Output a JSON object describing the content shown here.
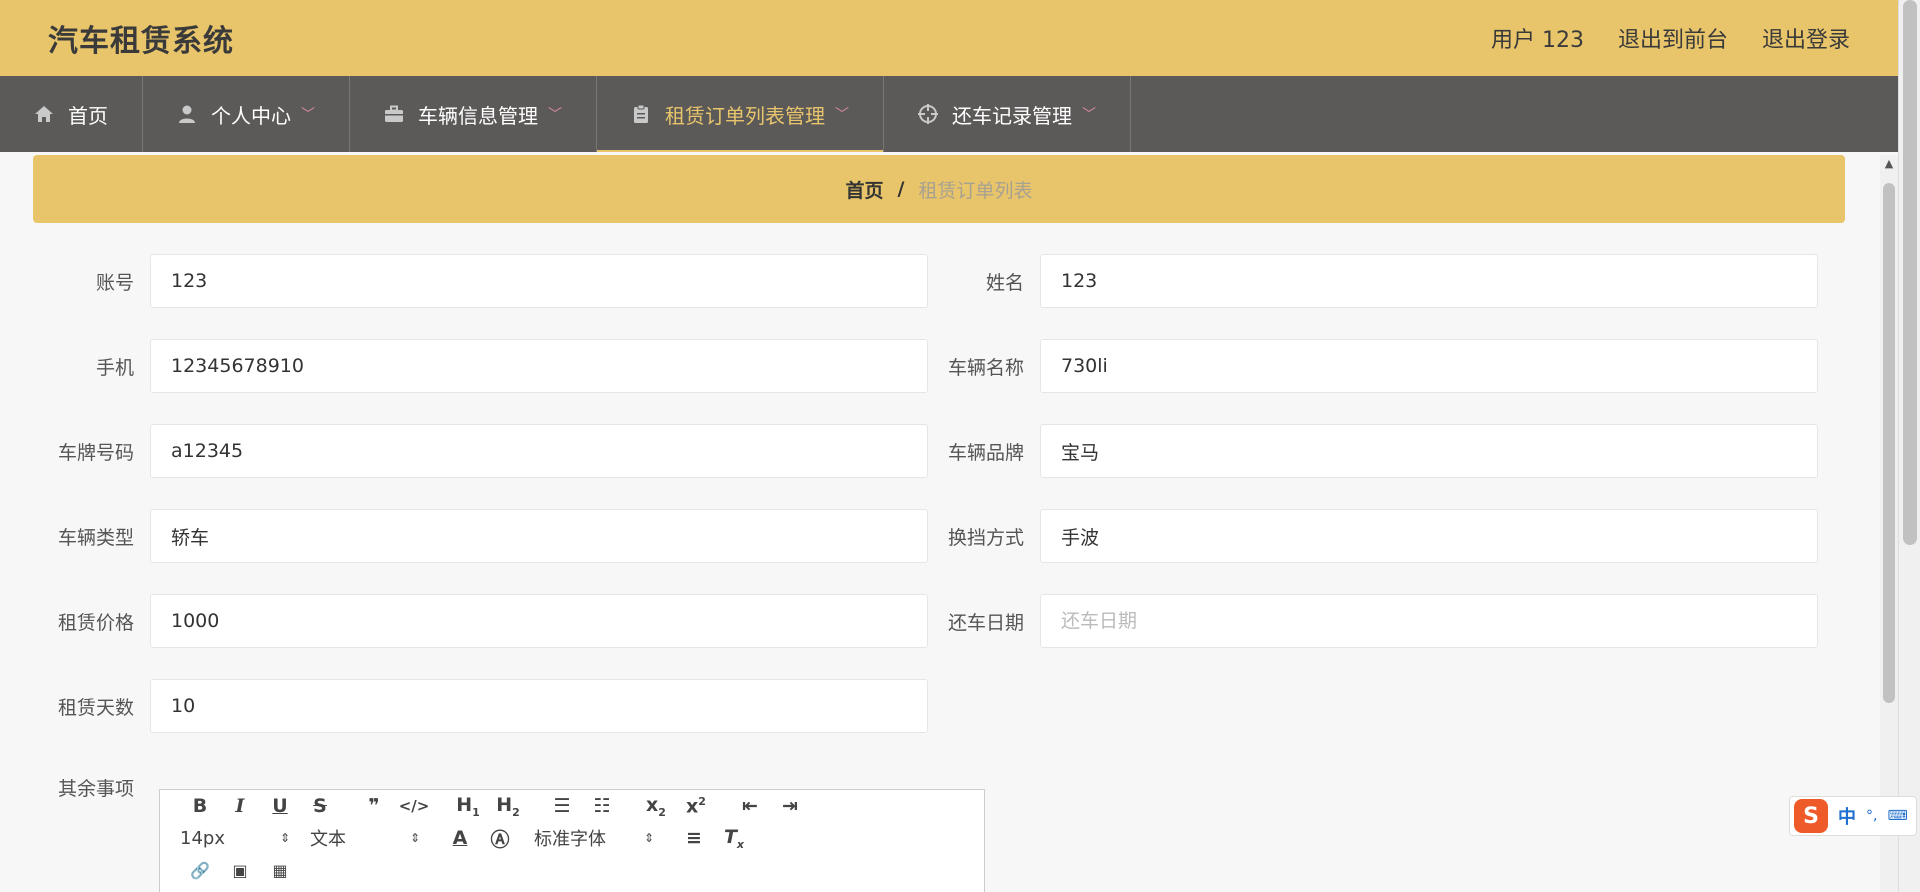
{
  "header": {
    "title": "汽车租赁系统",
    "user_label": "用户 123",
    "front_label": "退出到前台",
    "logout_label": "退出登录"
  },
  "nav": {
    "items": [
      {
        "label": "首页",
        "icon": "home-icon"
      },
      {
        "label": "个人中心",
        "icon": "user-icon"
      },
      {
        "label": "车辆信息管理",
        "icon": "briefcase-icon"
      },
      {
        "label": "租赁订单列表管理",
        "icon": "clipboard-icon",
        "active": true
      },
      {
        "label": "还车记录管理",
        "icon": "crosshair-icon"
      }
    ]
  },
  "breadcrumb": {
    "home": "首页",
    "separator": "/",
    "current": "租赁订单列表"
  },
  "form": {
    "account": {
      "label": "账号",
      "value": "123"
    },
    "name": {
      "label": "姓名",
      "value": "123"
    },
    "phone": {
      "label": "手机",
      "value": "12345678910"
    },
    "car_name": {
      "label": "车辆名称",
      "value": "730li"
    },
    "plate": {
      "label": "车牌号码",
      "value": "a12345"
    },
    "brand": {
      "label": "车辆品牌",
      "value": "宝马"
    },
    "car_type": {
      "label": "车辆类型",
      "value": "轿车"
    },
    "gear": {
      "label": "换挡方式",
      "value": "手波"
    },
    "price": {
      "label": "租赁价格",
      "value": "1000"
    },
    "return_date": {
      "label": "还车日期",
      "value": "",
      "placeholder": "还车日期"
    },
    "days": {
      "label": "租赁天数",
      "value": "10"
    },
    "other": {
      "label": "其余事项"
    }
  },
  "editor": {
    "font_size": "14px",
    "block_type": "文本",
    "font_family": "标准字体"
  },
  "ime": {
    "lang": "中",
    "punct": "°,"
  },
  "colors": {
    "header_bg": "#e8c56b",
    "nav_bg": "#5c5a59",
    "active": "#e8c56b"
  }
}
